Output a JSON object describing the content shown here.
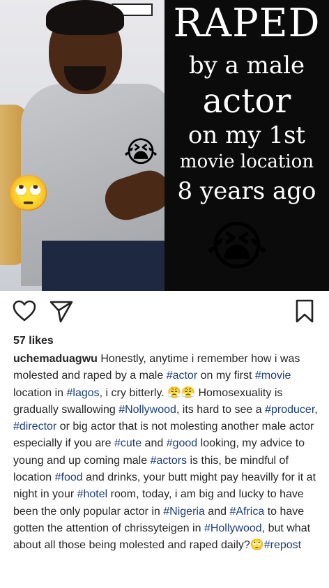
{
  "post_image": {
    "caption_lines": [
      "RAPED",
      "by a male",
      "actor",
      "on my 1st",
      "movie location",
      "8 years ago"
    ],
    "emojis": [
      "😭",
      "🙄",
      "😭"
    ]
  },
  "actions": {
    "like_icon": "heart-outline",
    "share_icon": "paper-plane",
    "save_icon": "bookmark-outline"
  },
  "likes_text": "57 likes",
  "caption": {
    "username": "uchemaduagwu",
    "segments": [
      {
        "t": " Honestly, anytime i remember how i was molested and raped by a male "
      },
      {
        "t": "#actor",
        "tag": true
      },
      {
        "t": " on my first "
      },
      {
        "t": "#movie",
        "tag": true
      },
      {
        "t": " location in "
      },
      {
        "t": "#lagos",
        "tag": true
      },
      {
        "t": ", i cry bitterly. 😤😤 Homosexuality is gradually swallowing "
      },
      {
        "t": "#Nollywood",
        "tag": true
      },
      {
        "t": ", its hard to see a "
      },
      {
        "t": "#producer",
        "tag": true
      },
      {
        "t": ", "
      },
      {
        "t": "#director",
        "tag": true
      },
      {
        "t": " or big actor that is not molesting another male actor especially if you are "
      },
      {
        "t": "#cute",
        "tag": true
      },
      {
        "t": " and "
      },
      {
        "t": "#good",
        "tag": true
      },
      {
        "t": " looking, my advice to young and up coming male "
      },
      {
        "t": "#actors",
        "tag": true
      },
      {
        "t": " is this, be mindful of location "
      },
      {
        "t": "#food",
        "tag": true
      },
      {
        "t": " and drinks, your butt might pay heavilly for it at night in your "
      },
      {
        "t": "#hotel",
        "tag": true
      },
      {
        "t": " room, today, i am big and lucky to have been the only popular actor in "
      },
      {
        "t": "#Nigeria",
        "tag": true
      },
      {
        "t": " and "
      },
      {
        "t": "#Africa",
        "tag": true
      },
      {
        "t": " to have gotten the attention of chrissyteigen  in "
      },
      {
        "t": "#Hollywood",
        "tag": true
      },
      {
        "t": ", but what about all those being molested and raped daily?🙄"
      },
      {
        "t": "#repost",
        "tag": true
      }
    ]
  }
}
